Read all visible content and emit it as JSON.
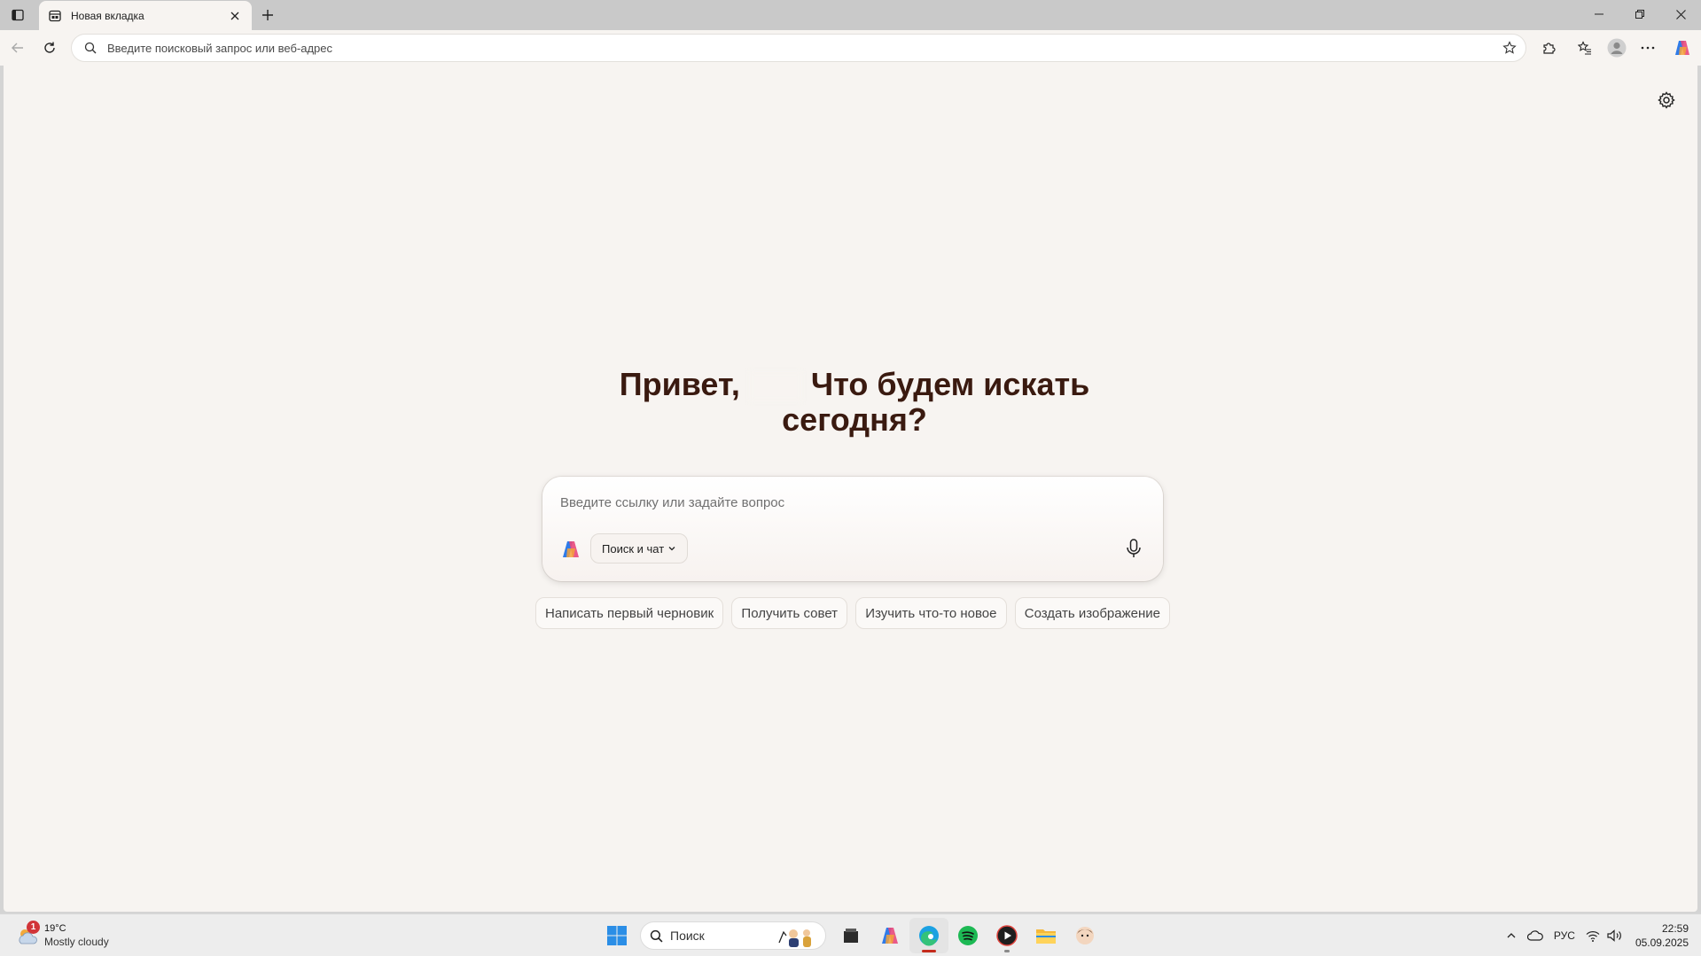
{
  "browser": {
    "tab_title": "Новая вкладка",
    "address_placeholder": "Введите поисковый запрос или веб-адрес"
  },
  "page": {
    "greeting_start": "Привет,",
    "greeting_end": "Что будем искать сегодня?",
    "composer_placeholder": "Введите ссылку или задайте вопрос",
    "mode_label": "Поиск и чат",
    "chips": [
      "Написать первый черновик",
      "Получить совет",
      "Изучить что-то новое",
      "Создать изображение"
    ]
  },
  "taskbar": {
    "weather_temp": "19°C",
    "weather_desc": "Mostly cloudy",
    "weather_badge": "1",
    "search_label": "Поиск",
    "language": "РУС",
    "time": "22:59",
    "date": "05.09.2025"
  },
  "icons": {
    "tab_actions": "tab-actions-icon",
    "favicon": "new-tab-page-icon",
    "settings": "gear-icon",
    "mic": "microphone-icon"
  },
  "colors": {
    "page_bg": "#f7f4f1",
    "heading": "#3a1a10",
    "accent_edge": "#c42b1c"
  }
}
